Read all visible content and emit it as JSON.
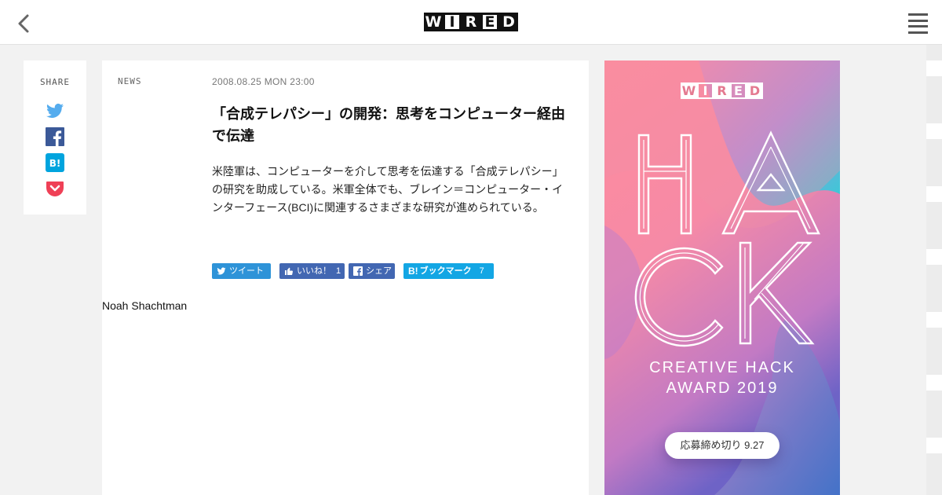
{
  "header": {
    "logo_letters": [
      "W",
      "I",
      "R",
      "E",
      "D"
    ],
    "back_icon": "chevron-left-icon",
    "menu_icon": "hamburger-menu-icon"
  },
  "share": {
    "label": "SHARE",
    "icons": [
      "twitter-icon",
      "facebook-icon",
      "hatena-bookmark-icon",
      "pocket-icon"
    ],
    "colors": {
      "twitter": "#55acee",
      "facebook": "#3b5998",
      "hatena": "#00a4de",
      "pocket": "#ef4056"
    }
  },
  "article": {
    "category": "NEWS",
    "date": "2008.08.25 MON 23:00",
    "title": "「合成テレパシー」の開発：思考をコンピューター経由で伝達",
    "lead": "米陸軍は、コンピューターを介して思考を伝達する「合成テレパシー」の研究を助成している。米軍全体でも、ブレイン＝コンピューター・インターフェース(BCI)に関連するさまざまな研究が進められている。",
    "author": "Noah Shachtman"
  },
  "social_buttons": {
    "tweet": "ツイート",
    "like": "いいね！",
    "like_count": "1",
    "fb_share": "シェア",
    "hatena": "ブックマーク",
    "hatena_count": "7",
    "colors": {
      "tweet": "#2e93d8",
      "facebook": "#4267b2",
      "hatena": "#13a6e4"
    }
  },
  "ad": {
    "logo_letters": [
      "W",
      "I",
      "R",
      "E",
      "D"
    ],
    "headline_letters": "HACK",
    "award_line1": "CREATIVE HACK",
    "award_line2": "AWARD 2019",
    "deadline": "応募締め切り 9.27",
    "colors": {
      "pink": "#f08fa6",
      "purple": "#8a6fd0",
      "cyan": "#30cfd8"
    }
  }
}
